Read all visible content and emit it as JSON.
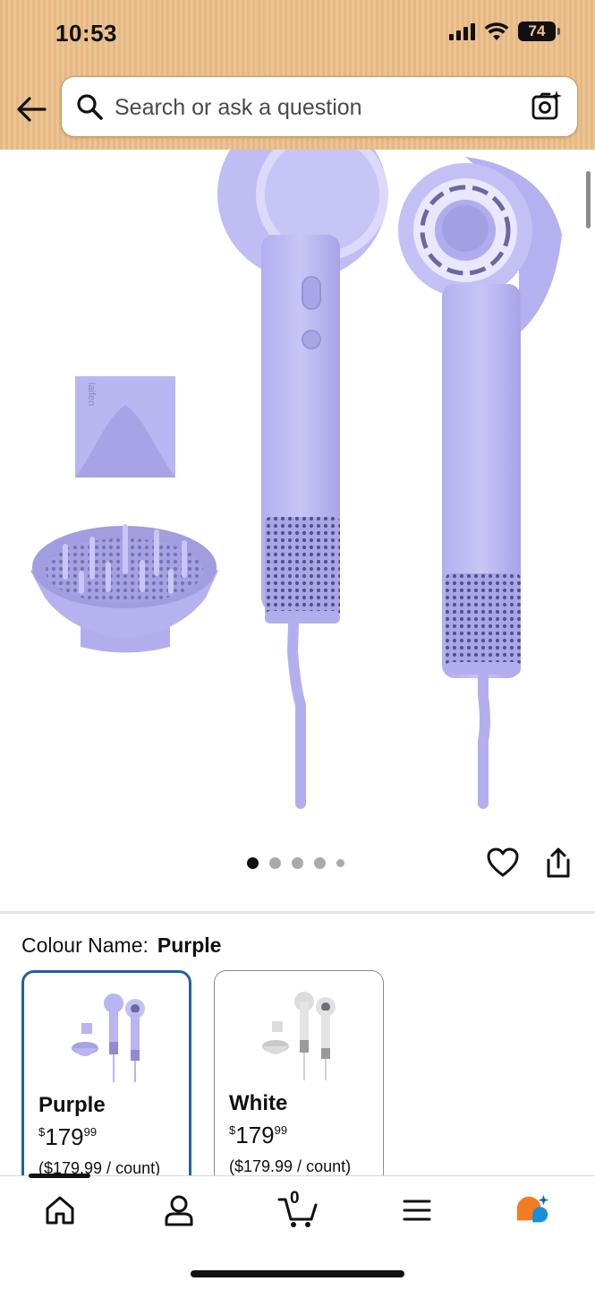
{
  "status_bar": {
    "time": "10:53",
    "battery": "74"
  },
  "search": {
    "placeholder": "Search or ask a question"
  },
  "gallery": {
    "image_count": 5,
    "active_index": 1,
    "brand_mark": "laifen"
  },
  "colour": {
    "label": "Colour Name:",
    "selected": "Purple",
    "options": [
      {
        "name": "Purple",
        "price_symbol": "$",
        "price_whole": "179",
        "price_fraction": "99",
        "unit_price": "($179.99 / count)",
        "selected": true,
        "color": "#b6b2ef"
      },
      {
        "name": "White",
        "price_symbol": "$",
        "price_whole": "179",
        "price_fraction": "99",
        "unit_price": "($179.99 / count)",
        "selected": false,
        "color": "#e9e9ea"
      }
    ]
  },
  "bottom_nav": {
    "items": [
      "home-icon",
      "account-icon",
      "cart-icon",
      "menu-icon",
      "rufus-icon"
    ],
    "cart_count": "0"
  },
  "colors": {
    "header": "#ecc493",
    "selected_border": "#2162a1",
    "product": "#b6b2ef",
    "rufus_orange": "#f47c20",
    "rufus_blue": "#1a8fd9"
  }
}
